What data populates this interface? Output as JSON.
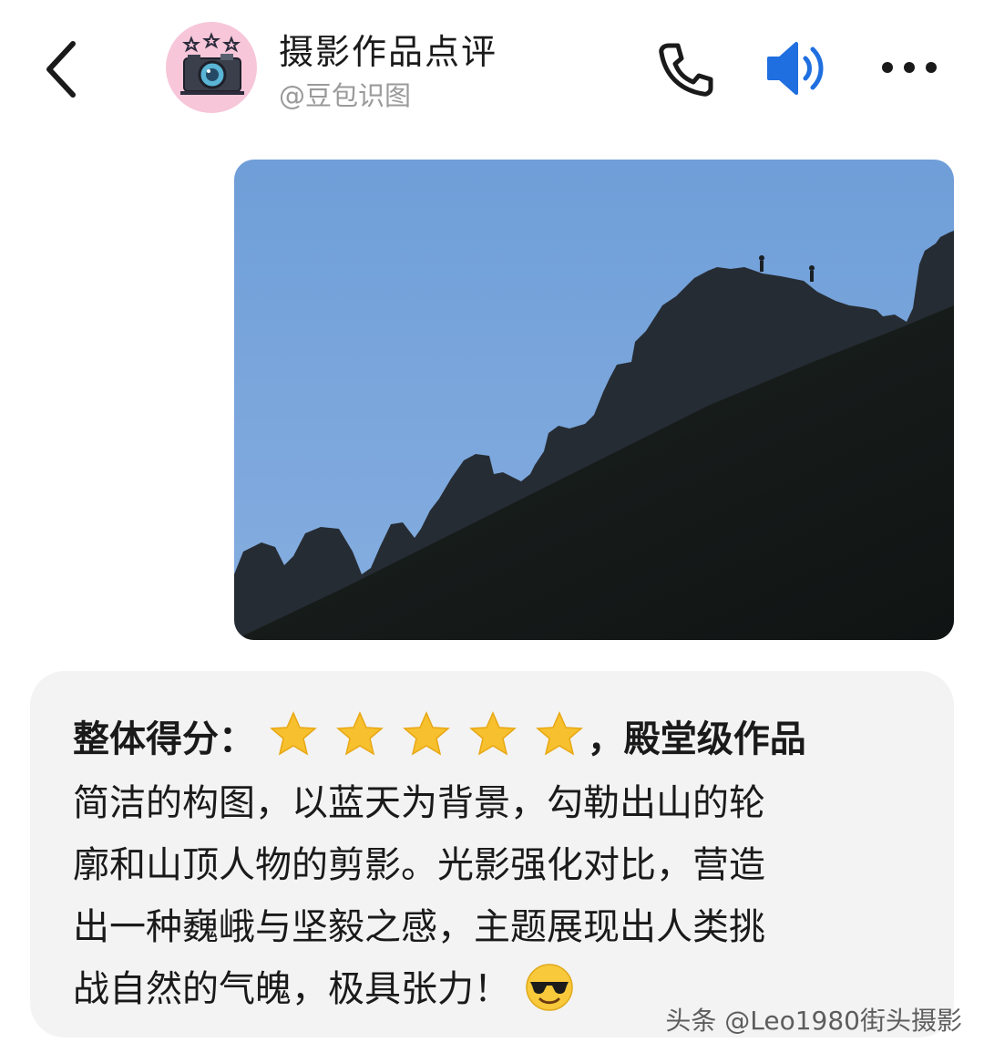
{
  "header": {
    "back_icon": "chevron-left-icon",
    "avatar_icon": "camera-with-stars-icon",
    "title": "摄影作品点评",
    "subtitle": "@豆包识图",
    "phone_icon": "phone-icon",
    "speaker_icon": "speaker-icon",
    "more_icon": "more-horizontal-icon",
    "accent_color": "#1f6fe0"
  },
  "photo": {
    "subject": "silhouetted mountain ridge with two climbers against blue sky"
  },
  "reply": {
    "score_label": "整体得分：",
    "star_count": 5,
    "rank_text": "，殿堂级作品",
    "lines": [
      "简洁的构图，以蓝天为背景，勾勒出山的轮",
      "廓和山顶人物的剪影。光影强化对比，营造",
      "出一种巍峨与坚毅之感，主题展现出人类挑",
      "战自然的气魄，极具张力！"
    ],
    "emoji": "sunglasses-face-emoji"
  },
  "watermark": "头条 @Leo1980街头摄影"
}
